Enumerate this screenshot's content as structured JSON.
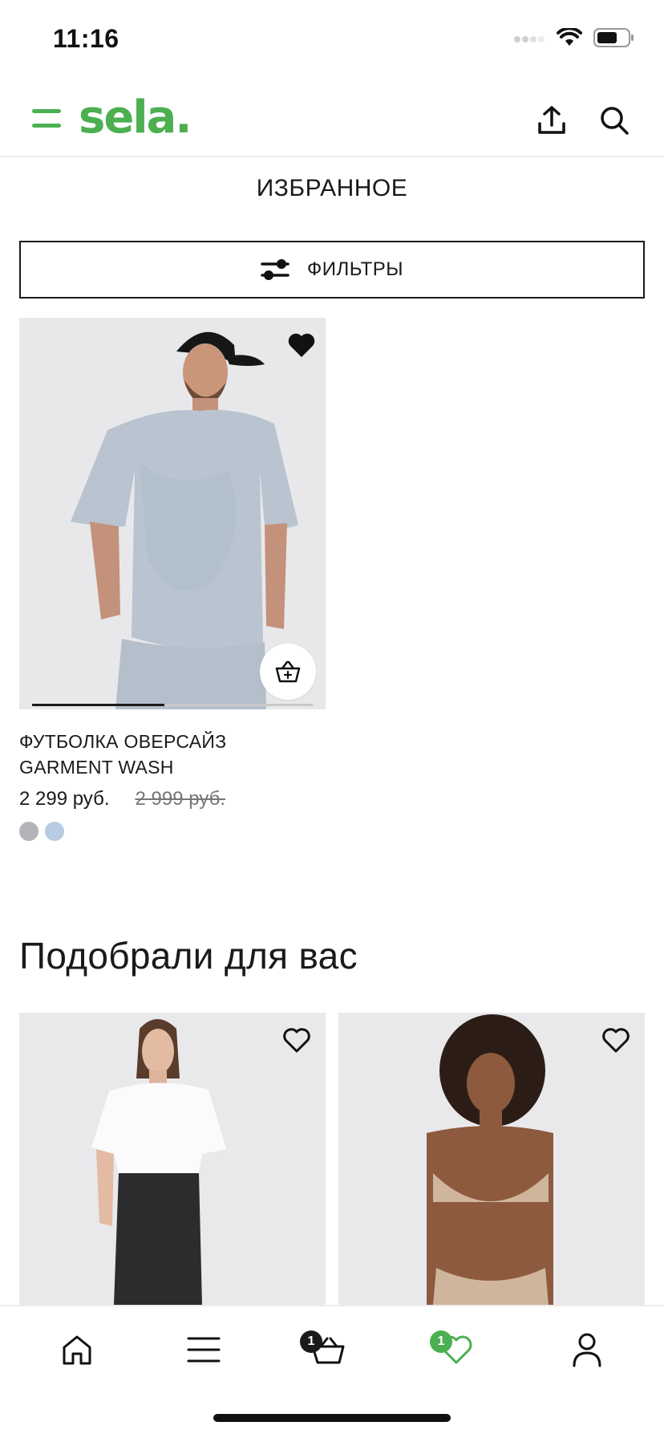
{
  "status_bar": {
    "time": "11:16"
  },
  "header": {
    "logo": "sela."
  },
  "page_title": "ИЗБРАННОЕ",
  "filters": {
    "label": "ФИЛЬТРЫ"
  },
  "favorites": [
    {
      "name": "ФУТБОЛКА ОВЕРСАЙЗ GARMENT WASH",
      "price": "2 299 руб.",
      "old_price": "2 999 руб.",
      "favorited": true,
      "image_progress": 0.47,
      "swatches": [
        "#b3b3b8",
        "#b8cbe2"
      ]
    }
  ],
  "recommendations": {
    "title": "Подобрали для вас",
    "items": [
      {
        "favorited": false
      },
      {
        "favorited": false
      }
    ]
  },
  "tab_bar": {
    "cart_badge": "1",
    "favorites_badge": "1"
  },
  "colors": {
    "brand": "#4caf50",
    "text": "#1a1a1a",
    "image_bg": "#e9e9ec"
  }
}
